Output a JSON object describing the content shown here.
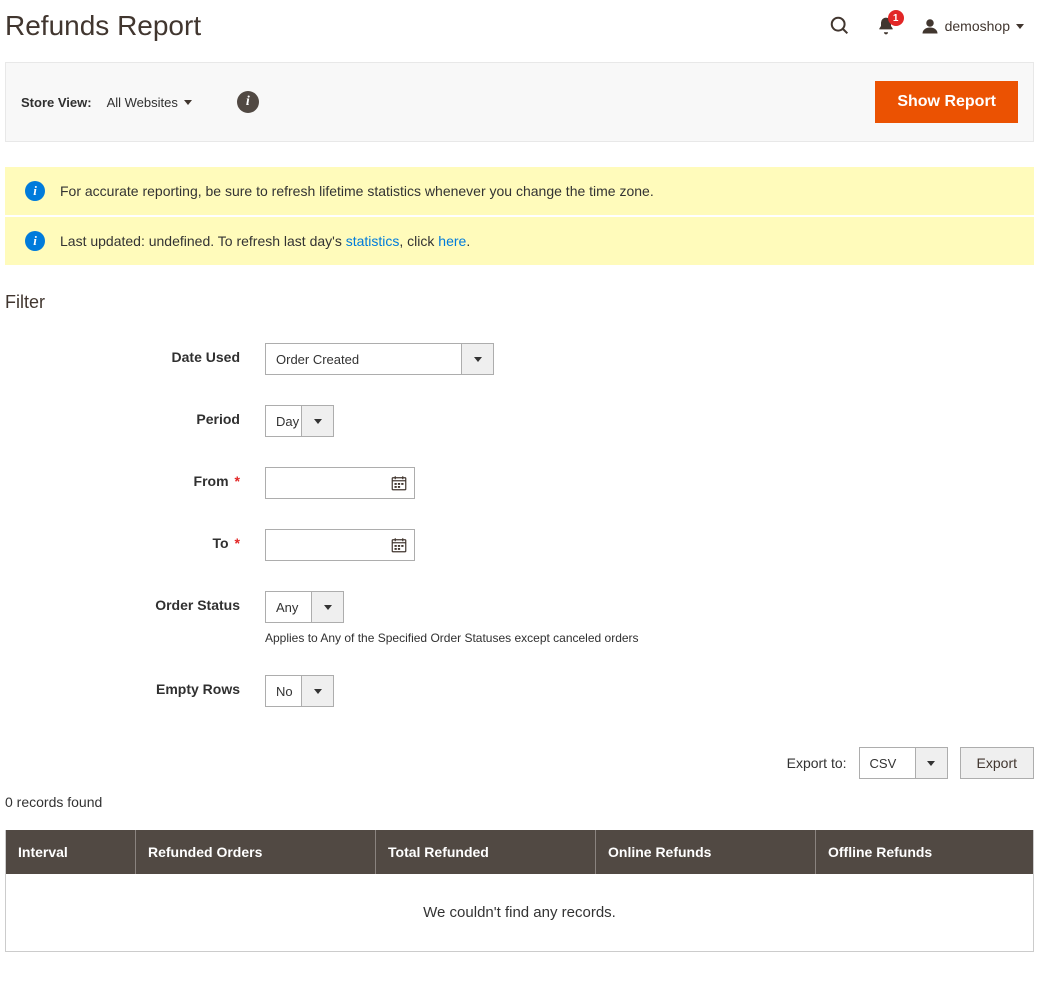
{
  "header": {
    "title": "Refunds Report",
    "notification_count": "1",
    "username": "demoshop"
  },
  "scope": {
    "label": "Store View:",
    "value": "All Websites",
    "action_button": "Show Report"
  },
  "messages": {
    "msg1": "For accurate reporting, be sure to refresh lifetime statistics whenever you change the time zone.",
    "msg2_pre": "Last updated: undefined. To refresh last day's ",
    "msg2_link1": "statistics",
    "msg2_mid": ", click ",
    "msg2_link2": "here",
    "msg2_post": "."
  },
  "filter": {
    "heading": "Filter",
    "date_used": {
      "label": "Date Used",
      "value": "Order Created"
    },
    "period": {
      "label": "Period",
      "value": "Day"
    },
    "from": {
      "label": "From",
      "value": ""
    },
    "to": {
      "label": "To",
      "value": ""
    },
    "order_status": {
      "label": "Order Status",
      "value": "Any",
      "note": "Applies to Any of the Specified Order Statuses except canceled orders"
    },
    "empty_rows": {
      "label": "Empty Rows",
      "value": "No"
    }
  },
  "export": {
    "label": "Export to:",
    "value": "CSV",
    "button": "Export"
  },
  "grid": {
    "records_found": "0 records found",
    "columns": {
      "interval": "Interval",
      "refunded_orders": "Refunded Orders",
      "total_refunded": "Total Refunded",
      "online_refunds": "Online Refunds",
      "offline_refunds": "Offline Refunds"
    },
    "empty_message": "We couldn't find any records."
  }
}
